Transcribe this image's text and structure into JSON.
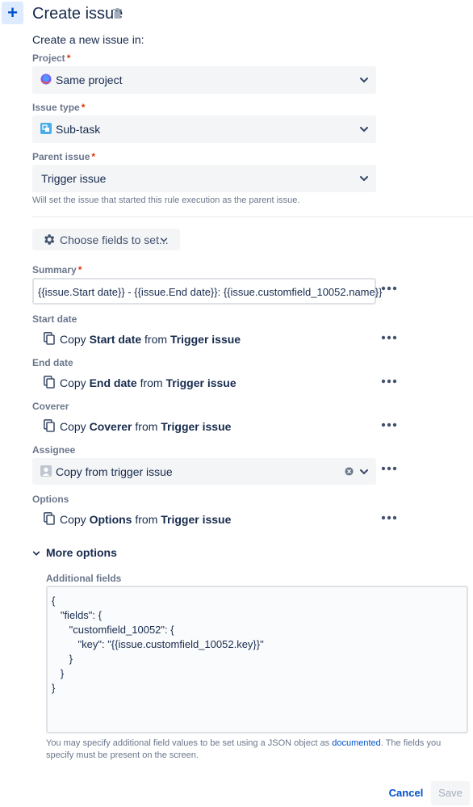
{
  "header": {
    "add_icon": "plus-icon",
    "title": "Create issue",
    "delete_icon": "trash-icon"
  },
  "intro": "Create a new issue in:",
  "required_marker": "*",
  "project": {
    "label": "Project",
    "value": "Same project",
    "icon": "project-globe-icon"
  },
  "issue_type": {
    "label": "Issue type",
    "value": "Sub-task",
    "icon": "subtask-icon"
  },
  "parent_issue": {
    "label": "Parent issue",
    "value": "Trigger issue",
    "helper": "Will set the issue that started this rule execution as the parent issue."
  },
  "choose_fields": {
    "label": "Choose fields to set...",
    "icon": "gear-icon"
  },
  "summary": {
    "label": "Summary",
    "value": "{{issue.Start date}} - {{issue.End date}}: {{issue.customfield_10052.name}}"
  },
  "copy_fields": [
    {
      "label": "Start date",
      "copy": "Copy",
      "field": "Start date",
      "from": "from",
      "source": "Trigger issue"
    },
    {
      "label": "End date",
      "copy": "Copy",
      "field": "End date",
      "from": "from",
      "source": "Trigger issue"
    },
    {
      "label": "Coverer",
      "copy": "Copy",
      "field": "Coverer",
      "from": "from",
      "source": "Trigger issue"
    }
  ],
  "assignee": {
    "label": "Assignee",
    "value": "Copy from trigger issue",
    "icon": "avatar-icon"
  },
  "options": {
    "label": "Options",
    "copy": "Copy",
    "field": "Options",
    "from": "from",
    "source": "Trigger issue"
  },
  "more_options": {
    "label": "More options",
    "expanded": true
  },
  "additional_fields": {
    "label": "Additional fields",
    "value": "{\n   \"fields\": {\n      \"customfield_10052\": {\n         \"key\": \"{{issue.customfield_10052.key}}\"\n      }\n   }\n}",
    "help_before": "You may specify additional field values to be set using a JSON object as ",
    "help_link": "documented",
    "help_after": ". The fields you specify must be present on the screen."
  },
  "footer": {
    "cancel": "Cancel",
    "save": "Save"
  },
  "colors": {
    "accent": "#0052cc",
    "required": "#de350b",
    "field_bg": "#f4f5f7"
  }
}
